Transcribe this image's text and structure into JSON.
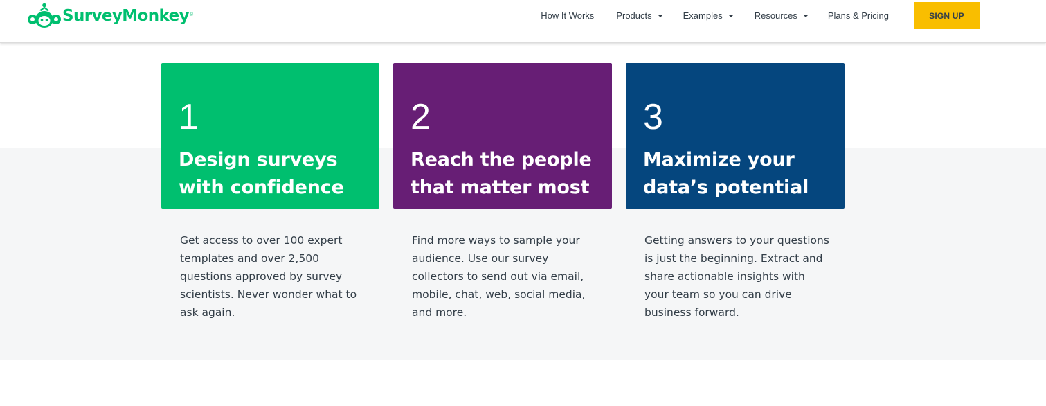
{
  "header": {
    "logo_text": "SurveyMonkey",
    "logo_mark": "®",
    "nav": {
      "how_it_works": "How It Works",
      "products": "Products",
      "examples": "Examples",
      "resources": "Resources",
      "plans_pricing": "Plans & Pricing"
    },
    "signup_label": "SIGN UP"
  },
  "colors": {
    "brand_green": "#00bf6f",
    "card1": "#00bf6f",
    "card2": "#671e75",
    "card3": "#05467e",
    "signup_yellow": "#f9be00",
    "band_gray": "#f5f6f7"
  },
  "icons": {
    "logo": "monkey-logo-icon",
    "dropdown": "caret-down-icon"
  },
  "cards": [
    {
      "number": "1",
      "title": "Design surveys with confidence",
      "description": "Get access to over 100 expert templates and over 2,500 questions approved by survey scientists. Never wonder what to ask again."
    },
    {
      "number": "2",
      "title": "Reach the people that matter most",
      "description": "Find more ways to sample your audience. Use our survey collectors to send out via email, mobile, chat, web, social media, and more."
    },
    {
      "number": "3",
      "title": "Maximize your data’s potential",
      "description": "Getting answers to your questions is just the beginning. Extract and share actionable insights with your team so you can drive business forward."
    }
  ]
}
